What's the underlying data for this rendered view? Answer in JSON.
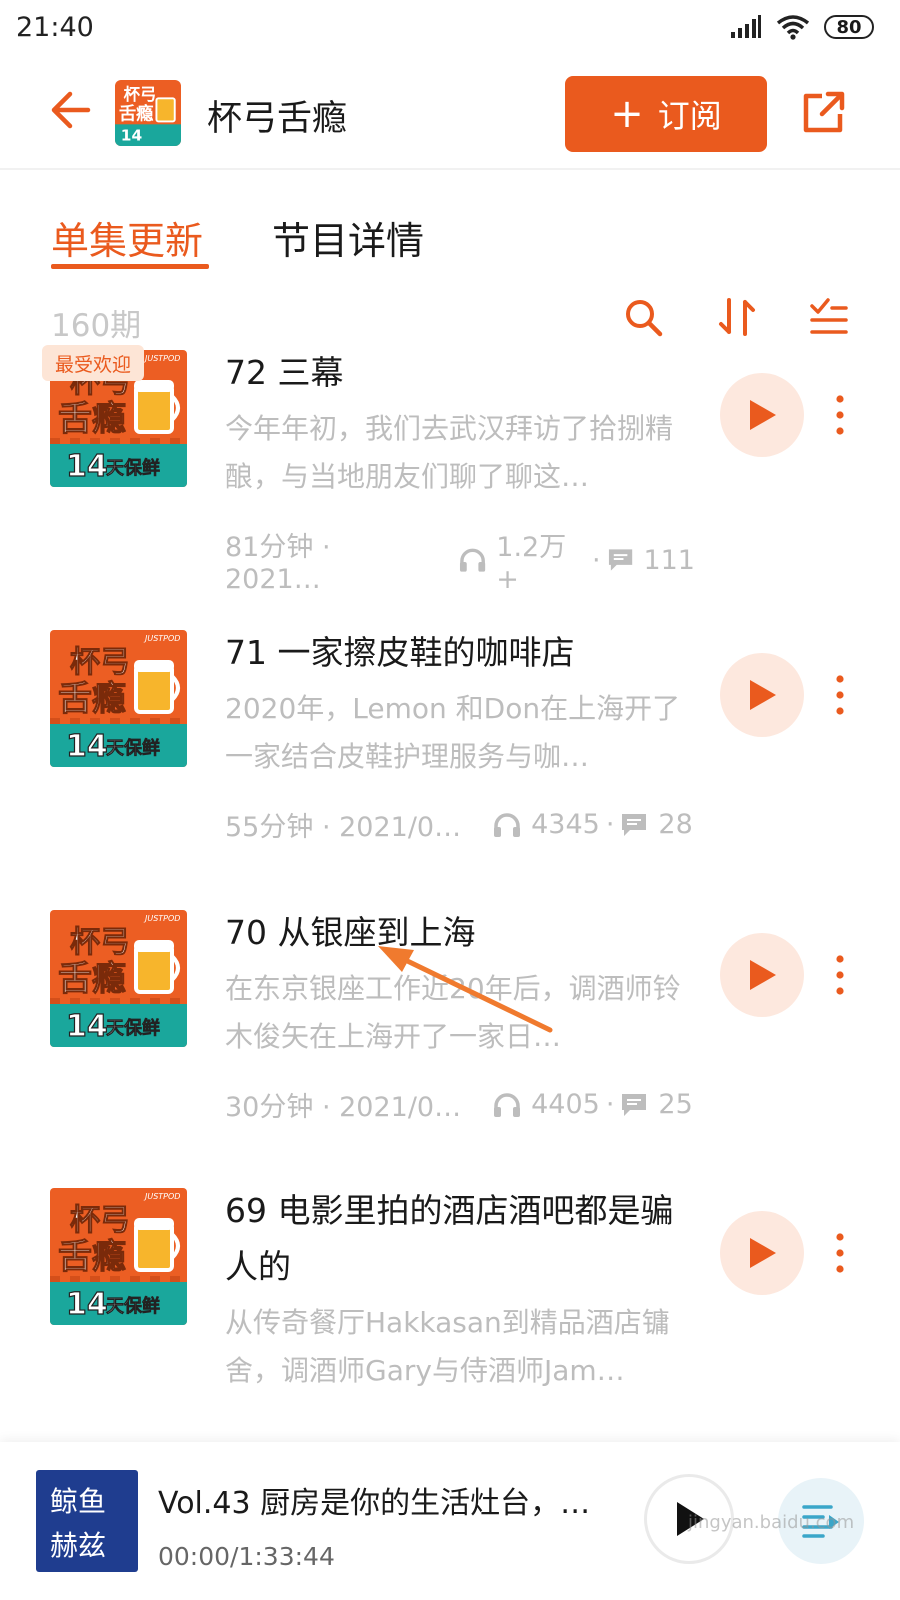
{
  "status_bar": {
    "time": "21:40",
    "battery": "80"
  },
  "header": {
    "title": "杯弓舌瘾",
    "subscribe_label": "订阅"
  },
  "cover_art": {
    "line1": "杯弓",
    "line2": "舌瘾",
    "days": "14",
    "days_suffix": "天保鲜",
    "brand": "JUSTPOD"
  },
  "tabs": [
    {
      "label": "单集更新",
      "active": true
    },
    {
      "label": "节目详情",
      "active": false
    }
  ],
  "toolbar": {
    "count": "160期"
  },
  "episodes": [
    {
      "title": "72 三幕",
      "badge": "最受欢迎",
      "desc": "今年年初，我们去武汉拜访了拾捌精酿，与当地朋友们聊了聊这…",
      "duration": "81分钟 · 2021…",
      "plays": "1.2万+",
      "comments": "111"
    },
    {
      "title": "71 一家擦皮鞋的咖啡店",
      "desc": "2020年，Lemon 和Don在上海开了一家结合皮鞋护理服务与咖…",
      "duration": "55分钟 · 2021/0…",
      "plays": "4345",
      "comments": "28"
    },
    {
      "title": "70 从银座到上海",
      "desc": "在东京银座工作近20年后，调酒师铃木俊矢在上海开了一家日…",
      "duration": "30分钟 · 2021/0…",
      "plays": "4405",
      "comments": "25"
    },
    {
      "title": "69 电影里拍的酒店酒吧都是骗人的",
      "desc": "从传奇餐厅Hakkasan到精品酒店镛舍，调酒师Gary与侍酒师Jam…"
    }
  ],
  "player": {
    "title": "Vol.43 厨房是你的生活灶台，…",
    "time": "00:00/1:33:44",
    "cover_line1": "鲸鱼",
    "cover_line2": "赫兹"
  },
  "watermark": "jingyan.baidu.com",
  "colors": {
    "accent": "#ea5a1e",
    "play_bg": "#fde8de",
    "muted_text": "#bdbdbd"
  }
}
